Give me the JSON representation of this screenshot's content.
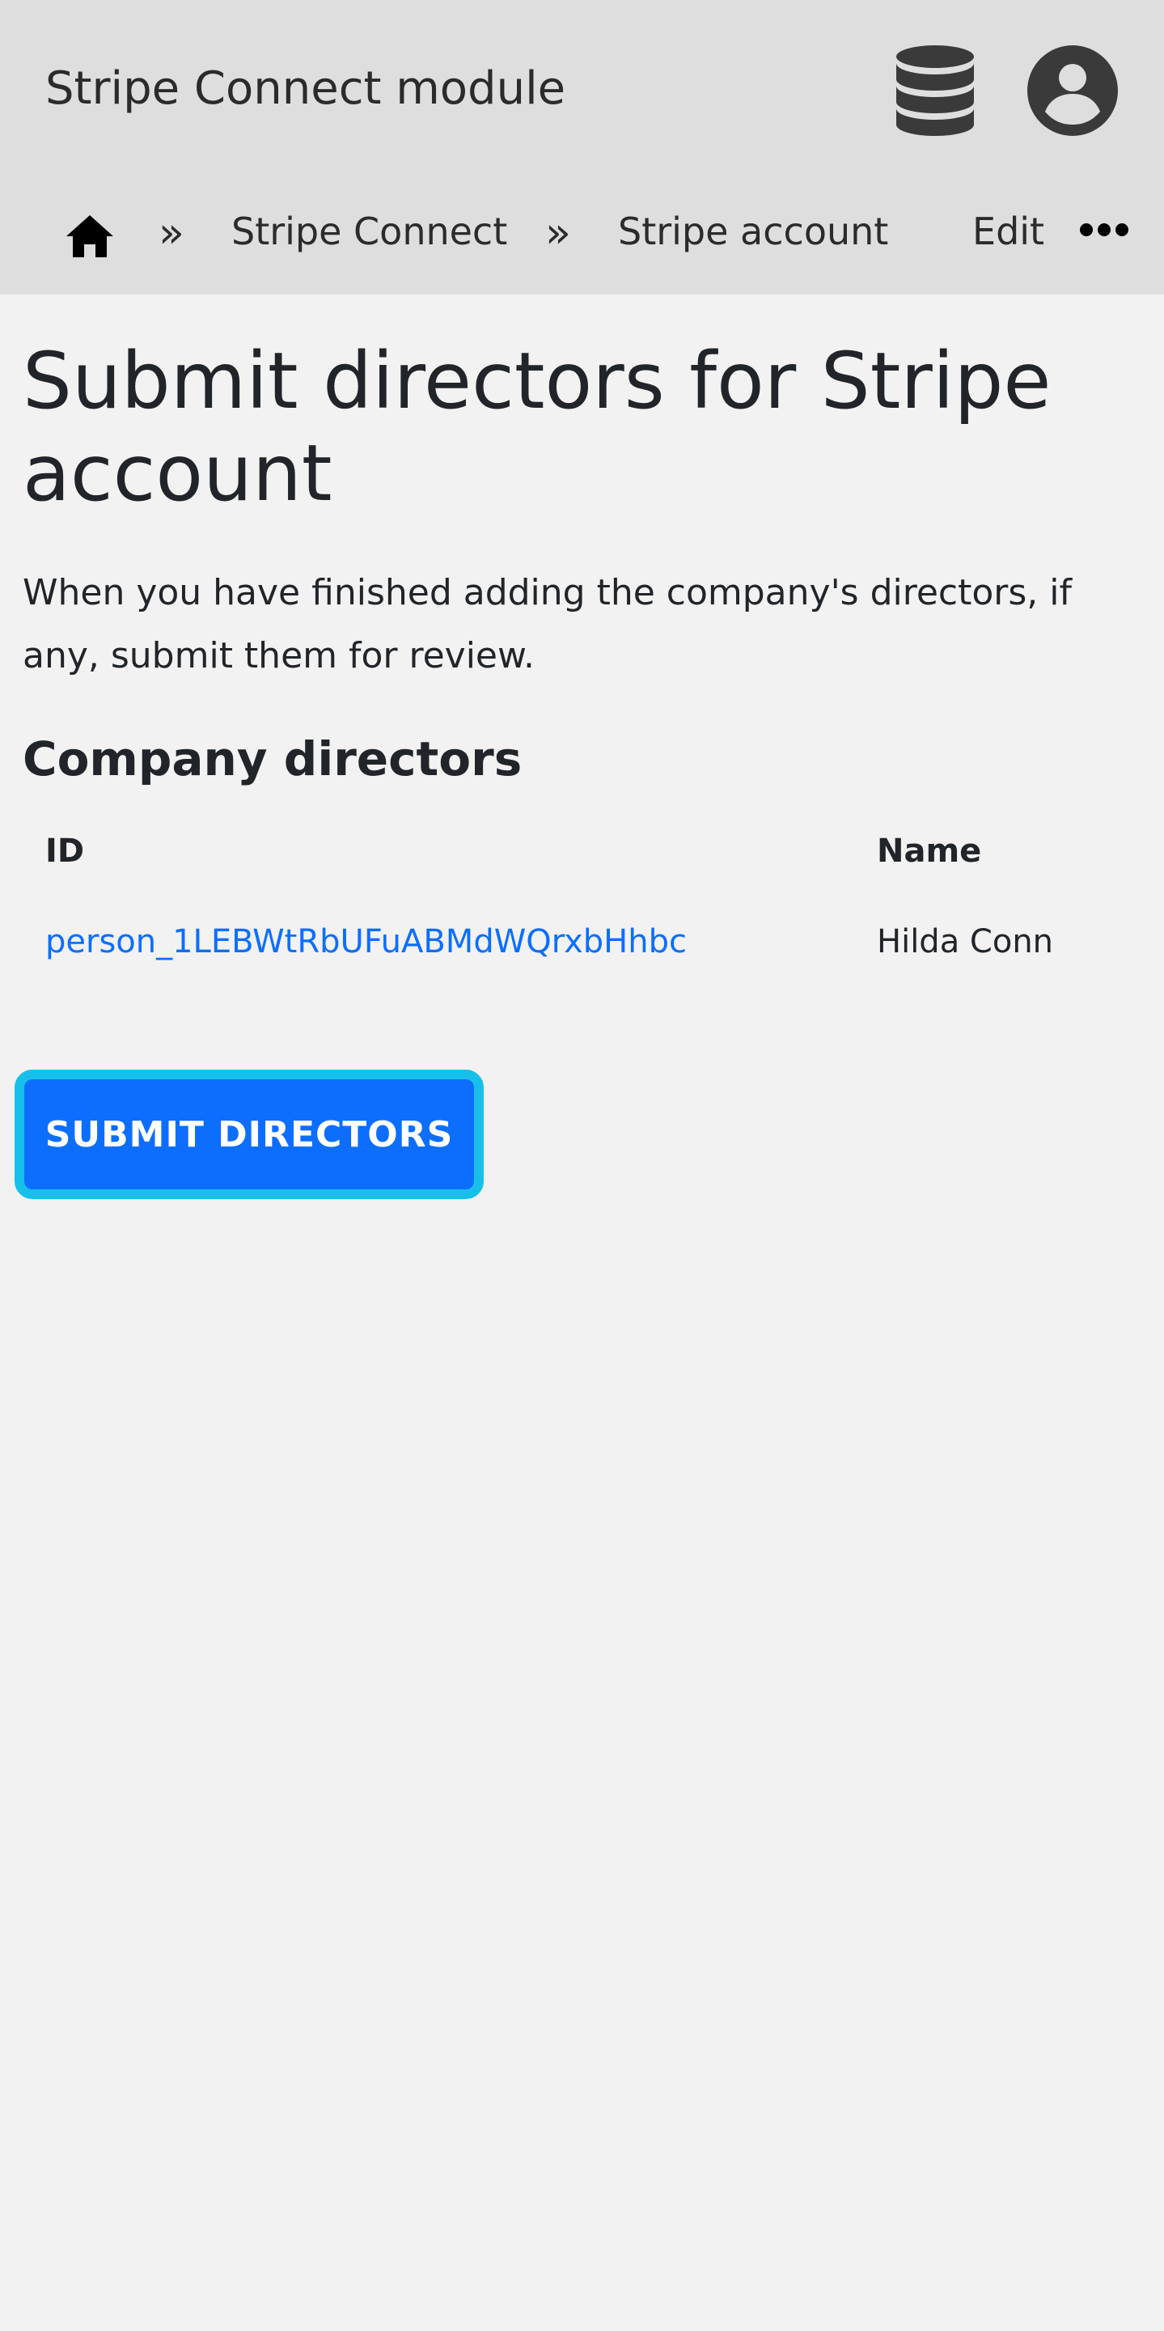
{
  "header": {
    "app_title": "Stripe Connect module",
    "icons": [
      "database-icon",
      "user-account-icon"
    ]
  },
  "breadcrumb": {
    "items": [
      {
        "label": "Stripe Connect"
      },
      {
        "label": "Stripe account"
      },
      {
        "label": "Edit"
      }
    ],
    "separator": "»",
    "icons": [
      "home-icon",
      "more-icon"
    ]
  },
  "main": {
    "title": "Submit directors for Stripe account",
    "intro": "When you have finished adding the company's directors, if any, submit them for review.",
    "section_title": "Company directors",
    "table": {
      "columns": [
        "ID",
        "Name"
      ],
      "rows": [
        {
          "id": "person_1LEBWtRbUFuABMdWQrxbHhbc",
          "name": "Hilda Conn"
        }
      ]
    },
    "submit_label": "SUBMIT DIRECTORS"
  },
  "colors": {
    "topbar": "#dedede",
    "page_bg": "#f2f2f2",
    "link": "#0d6efd",
    "button": "#0d6efd",
    "button_focus_ring": "#17c0ea",
    "icon": "#3a3a3a"
  }
}
